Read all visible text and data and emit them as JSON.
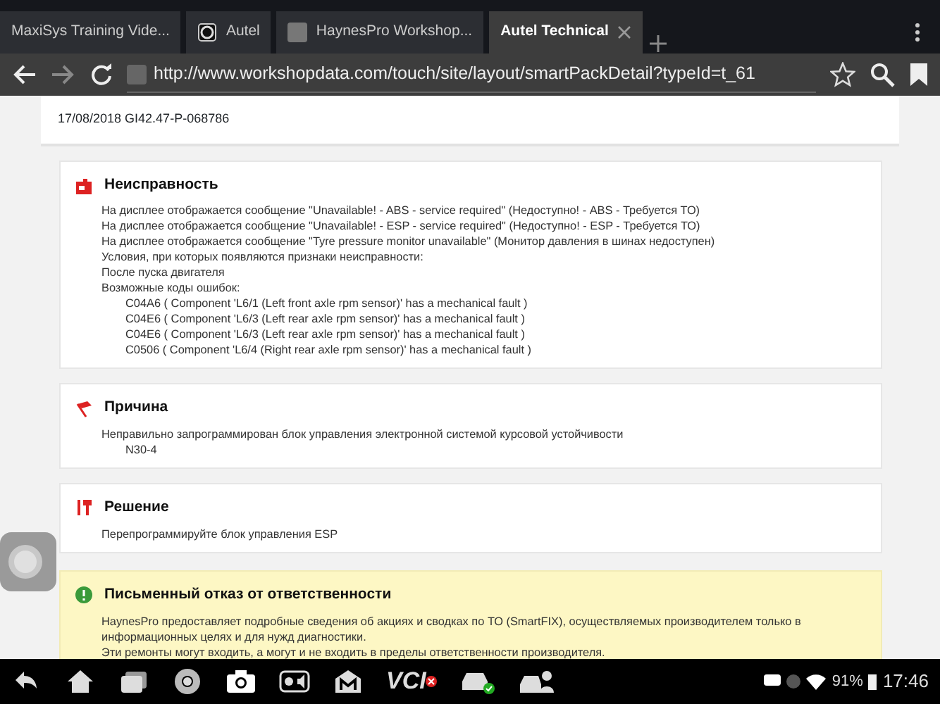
{
  "browser": {
    "tabs": [
      {
        "kind": "plain",
        "title": "MaxiSys Training Vide...",
        "selected": false
      },
      {
        "kind": "logo",
        "title": "Autel",
        "selected": false
      },
      {
        "kind": "page",
        "title": "HaynesPro Workshop...",
        "selected": false
      },
      {
        "kind": "plain",
        "title": "Autel Technical",
        "selected": true
      }
    ],
    "url": "http://www.workshopdata.com/touch/site/layout/smartPackDetail?typeId=t_61"
  },
  "page": {
    "header": "17/08/2018 GI42.47-P-068786",
    "sections": [
      {
        "kind": "fault",
        "title": "Неисправность",
        "lines": [
          {
            "text": "На дисплее отображается сообщение \"Unavailable! - ABS - service required\" (Недоступно! - ABS - Требуется ТО)"
          },
          {
            "text": "На дисплее отображается сообщение \"Unavailable! - ESP - service required\" (Недоступно! - ESP - Требуется ТО)"
          },
          {
            "text": "На дисплее отображается сообщение \"Tyre pressure monitor unavailable\" (Монитор давления в шинах недоступен)"
          },
          {
            "text": "Условия, при которых появляются признаки неисправности:"
          },
          {
            "text": "После пуска двигателя"
          },
          {
            "text": "Возможные коды ошибок:",
            "children": [
              {
                "text": "C04A6 ( Component 'L6/1 (Left front axle rpm sensor)' has a mechanical fault )"
              },
              {
                "text": "C04E6 ( Component 'L6/3 (Left rear axle rpm sensor)' has a mechanical fault )"
              },
              {
                "text": "C04E6 ( Component 'L6/3 (Left rear axle rpm sensor)' has a mechanical fault )"
              },
              {
                "text": "C0506 ( Component 'L6/4 (Right rear axle rpm sensor)' has a mechanical fault )"
              }
            ]
          }
        ]
      },
      {
        "kind": "cause",
        "title": "Причина",
        "lines": [
          {
            "text": "Неправильно запрограммирован блок управления электронной системой курсовой устойчивости",
            "children": [
              {
                "text": "N30-4"
              }
            ]
          }
        ]
      },
      {
        "kind": "solution",
        "title": "Решение",
        "lines": [
          {
            "text": "Перепрограммируйте блок управления ESP"
          }
        ]
      },
      {
        "kind": "disclaimer",
        "title": "Письменный отказ от ответственности",
        "lines": [
          {
            "text": "HaynesPro предоставляет подробные сведения об акциях и сводках по ТО (SmartFIX), осуществляемых производителем только в информационных целях и для нужд диагностики."
          },
          {
            "text": "Эти ремонты могут входить, а могут и не входить в пределы ответственности производителя."
          }
        ]
      }
    ]
  },
  "taskbar": {
    "vci_label": "VCI",
    "battery": "91%",
    "time": "17:46"
  }
}
